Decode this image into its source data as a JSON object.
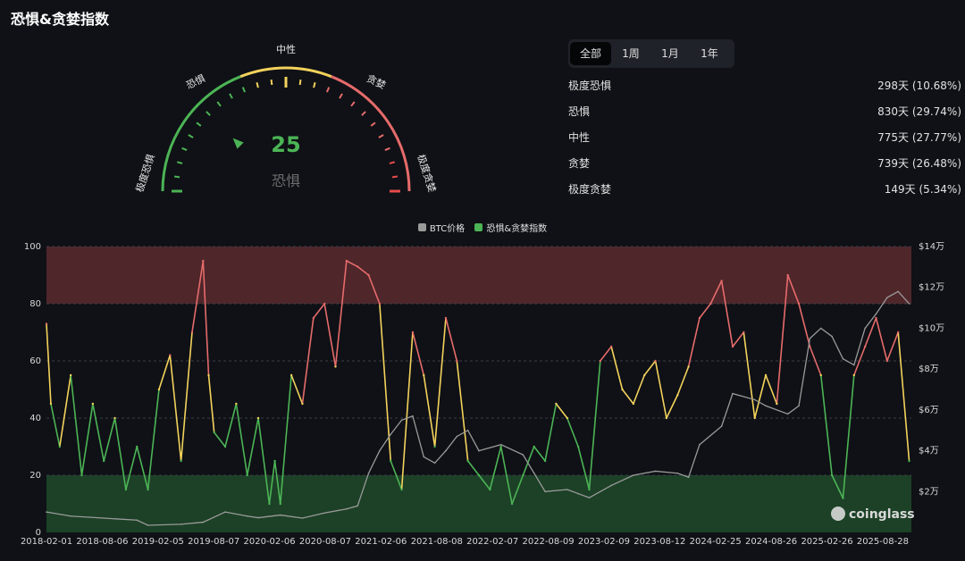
{
  "title": "恐惧&贪婪指数",
  "gauge": {
    "value": 25,
    "value_text": "25",
    "label": "恐惧",
    "zones": [
      "极度恐惧",
      "恐惧",
      "中性",
      "贪婪",
      "极度贪婪"
    ],
    "colors": {
      "fear": "#4cb455",
      "neutral": "#f3d25c",
      "greed": "#e66b6b",
      "extreme_greed": "#e64b4b"
    }
  },
  "tabs": [
    {
      "label": "全部",
      "active": true
    },
    {
      "label": "1周",
      "active": false
    },
    {
      "label": "1月",
      "active": false
    },
    {
      "label": "1年",
      "active": false
    }
  ],
  "stats": [
    {
      "label": "极度恐惧",
      "value": "298天 (10.68%)"
    },
    {
      "label": "恐惧",
      "value": "830天 (29.74%)"
    },
    {
      "label": "中性",
      "value": "775天 (27.77%)"
    },
    {
      "label": "贪婪",
      "value": "739天 (26.48%)"
    },
    {
      "label": "极度贪婪",
      "value": "149天 (5.34%)"
    }
  ],
  "legend": [
    {
      "label": "BTC价格",
      "color": "#9a9a9a"
    },
    {
      "label": "恐惧&贪婪指数",
      "color": "#4cb455"
    }
  ],
  "watermark": "coinglass",
  "chart_data": {
    "type": "line",
    "x_ticks": [
      "2018-02-01",
      "2018-08-06",
      "2019-02-05",
      "2019-08-07",
      "2020-02-06",
      "2020-08-07",
      "2021-02-06",
      "2021-08-08",
      "2022-02-07",
      "2022-08-09",
      "2023-02-09",
      "2023-08-12",
      "2024-02-25",
      "2024-08-26",
      "2025-02-26",
      "2025-08-28"
    ],
    "y_left_ticks": [
      "0",
      "20",
      "40",
      "60",
      "80",
      "100"
    ],
    "y_left_range": [
      0,
      100
    ],
    "y_right_ticks": [
      "$2万",
      "$4万",
      "$6万",
      "$8万",
      "$10万",
      "$12万",
      "$14万"
    ],
    "y_right_range": [
      0,
      140000
    ],
    "zones": [
      {
        "from": 0,
        "to": 20,
        "color": "#1f4a2a"
      },
      {
        "from": 80,
        "to": 100,
        "color": "#5a2a2e"
      }
    ],
    "series": [
      {
        "name": "恐惧&贪婪指数",
        "axis": "left",
        "x": [
          2018.08,
          2018.12,
          2018.2,
          2018.3,
          2018.4,
          2018.5,
          2018.6,
          2018.7,
          2018.8,
          2018.9,
          2019.0,
          2019.1,
          2019.2,
          2019.3,
          2019.4,
          2019.5,
          2019.55,
          2019.6,
          2019.7,
          2019.8,
          2019.9,
          2020.0,
          2020.1,
          2020.15,
          2020.2,
          2020.3,
          2020.4,
          2020.5,
          2020.6,
          2020.7,
          2020.8,
          2020.9,
          2021.0,
          2021.1,
          2021.2,
          2021.3,
          2021.4,
          2021.5,
          2021.6,
          2021.7,
          2021.8,
          2021.9,
          2022.0,
          2022.1,
          2022.2,
          2022.3,
          2022.4,
          2022.5,
          2022.6,
          2022.7,
          2022.8,
          2022.9,
          2023.0,
          2023.1,
          2023.2,
          2023.3,
          2023.4,
          2023.5,
          2023.6,
          2023.7,
          2023.8,
          2023.9,
          2024.0,
          2024.1,
          2024.2,
          2024.3,
          2024.4,
          2024.5,
          2024.6,
          2024.7,
          2024.8,
          2024.9,
          2025.0,
          2025.1,
          2025.2,
          2025.3,
          2025.4,
          2025.5,
          2025.6,
          2025.7,
          2025.8,
          2025.9
        ],
        "y": [
          73,
          45,
          30,
          55,
          20,
          45,
          25,
          40,
          15,
          30,
          15,
          50,
          62,
          25,
          70,
          95,
          55,
          35,
          30,
          45,
          20,
          40,
          10,
          25,
          10,
          55,
          45,
          75,
          80,
          58,
          95,
          93,
          90,
          80,
          25,
          15,
          70,
          55,
          30,
          75,
          60,
          25,
          20,
          15,
          30,
          10,
          20,
          30,
          25,
          45,
          40,
          30,
          15,
          60,
          65,
          50,
          45,
          55,
          60,
          40,
          48,
          58,
          75,
          80,
          88,
          65,
          70,
          40,
          55,
          45,
          90,
          80,
          65,
          55,
          20,
          12,
          55,
          65,
          75,
          60,
          70,
          25
        ],
        "color_by_zone": {
          "below_40": "#4cb455",
          "40_to_60": "#f3d25c",
          "above_60": "#e66b6b"
        }
      },
      {
        "name": "BTC价格",
        "axis": "right",
        "color": "#9a9a9a",
        "x": [
          2018.08,
          2018.3,
          2018.6,
          2018.9,
          2019.0,
          2019.3,
          2019.5,
          2019.7,
          2019.9,
          2020.0,
          2020.2,
          2020.4,
          2020.6,
          2020.8,
          2020.9,
          2021.0,
          2021.1,
          2021.2,
          2021.3,
          2021.4,
          2021.5,
          2021.6,
          2021.7,
          2021.8,
          2021.9,
          2022.0,
          2022.2,
          2022.4,
          2022.5,
          2022.6,
          2022.8,
          2022.9,
          2023.0,
          2023.2,
          2023.4,
          2023.6,
          2023.8,
          2023.9,
          2024.0,
          2024.2,
          2024.3,
          2024.5,
          2024.6,
          2024.8,
          2024.9,
          2025.0,
          2025.1,
          2025.2,
          2025.3,
          2025.4,
          2025.5,
          2025.6,
          2025.7,
          2025.8,
          2025.9
        ],
        "y": [
          10000,
          8000,
          7000,
          6000,
          3500,
          4000,
          5000,
          10000,
          8000,
          7200,
          8500,
          7000,
          9500,
          11500,
          13000,
          29000,
          40000,
          48000,
          55000,
          57000,
          37000,
          34000,
          40000,
          47000,
          50000,
          40000,
          43000,
          38000,
          29000,
          20000,
          21000,
          19000,
          17000,
          23000,
          28000,
          30000,
          29000,
          27000,
          43000,
          52000,
          68000,
          65000,
          62000,
          58000,
          62000,
          95000,
          100000,
          96000,
          85000,
          82000,
          100000,
          107000,
          115000,
          118000,
          112000
        ]
      }
    ]
  }
}
